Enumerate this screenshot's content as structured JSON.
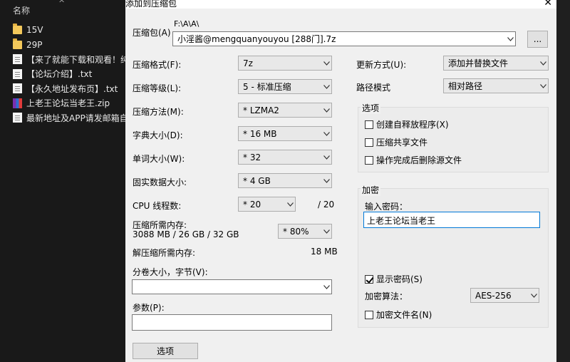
{
  "explorer": {
    "header_label": "名称",
    "sort_caret": "^",
    "items": [
      {
        "name": "15V",
        "type": "folder"
      },
      {
        "name": "29P",
        "type": "folder"
      },
      {
        "name": "【来了就能下载和观看！纯",
        "type": "txt"
      },
      {
        "name": "【论坛介绍】.txt",
        "type": "txt"
      },
      {
        "name": "【永久地址发布页】.txt",
        "type": "txt"
      },
      {
        "name": "上老王论坛当老王.zip",
        "type": "zip"
      },
      {
        "name": "最新地址及APP请发邮箱自",
        "type": "txt"
      }
    ]
  },
  "dialog": {
    "title": "添加到压缩包",
    "close_glyph": "✕",
    "archive": {
      "label": "压缩包(A)",
      "path": "F:\\A\\A\\",
      "filename": "小淫酱@mengquanyouyou [288门].7z",
      "browse_label": "..."
    },
    "left": {
      "format": {
        "label": "压缩格式(F):",
        "value": "7z"
      },
      "level": {
        "label": "压缩等级(L):",
        "value": "5 - 标准压缩"
      },
      "method": {
        "label": "压缩方法(M):",
        "value": "* LZMA2"
      },
      "dict": {
        "label": "字典大小(D):",
        "value": "* 16 MB"
      },
      "word": {
        "label": "单词大小(W):",
        "value": "* 32"
      },
      "solid": {
        "label": "固实数据大小:",
        "value": "* 4 GB"
      },
      "cpu": {
        "label": "CPU 线程数:",
        "value": "* 20",
        "total": "/ 20"
      },
      "mem_comp": {
        "label": "压缩所需内存:",
        "detail": "3088 MB / 26 GB / 32 GB",
        "value": "* 80%"
      },
      "mem_decomp": {
        "label": "解压缩所需内存:",
        "value": "18 MB"
      },
      "split": {
        "label": "分卷大小，字节(V):",
        "value": ""
      },
      "params": {
        "label": "参数(P):",
        "value": ""
      },
      "options_button": "选项"
    },
    "right": {
      "update": {
        "label": "更新方式(U):",
        "value": "添加并替换文件"
      },
      "pathmode": {
        "label": "路径模式",
        "value": "相对路径"
      },
      "options_group": {
        "title": "选项",
        "sfx": "创建自释放程序(X)",
        "shared": "压缩共享文件",
        "delete": "操作完成后删除源文件"
      },
      "encrypt_group": {
        "title": "加密",
        "password_label": "输入密码：",
        "password_value": "上老王论坛当老王",
        "show_password": "显示密码(S)",
        "algo_label": "加密算法：",
        "algo_value": "AES-256",
        "encrypt_names": "加密文件名(N)"
      }
    }
  }
}
